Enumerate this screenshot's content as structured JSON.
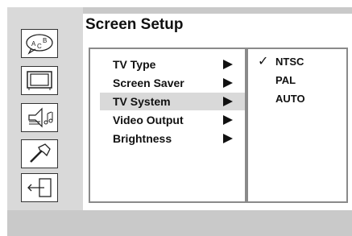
{
  "title": "Screen Setup",
  "sidebar": {
    "icons": [
      "language-icon",
      "tv-icon",
      "audio-icon",
      "tools-icon",
      "exit-icon"
    ]
  },
  "menu": {
    "items": [
      {
        "label": "TV Type"
      },
      {
        "label": "Screen Saver"
      },
      {
        "label": "TV System"
      },
      {
        "label": "Video Output"
      },
      {
        "label": "Brightness"
      }
    ],
    "selected": "TV System"
  },
  "submenu": {
    "options": [
      {
        "label": "NTSC",
        "checked": true
      },
      {
        "label": "PAL",
        "checked": false
      },
      {
        "label": "AUTO",
        "checked": false
      }
    ],
    "check_glyph": "✓"
  },
  "colors": {
    "sidebar_bg": "#d9d9d9",
    "footer_bg": "#c9c9c9",
    "selected_bg": "#d9d9d9"
  }
}
